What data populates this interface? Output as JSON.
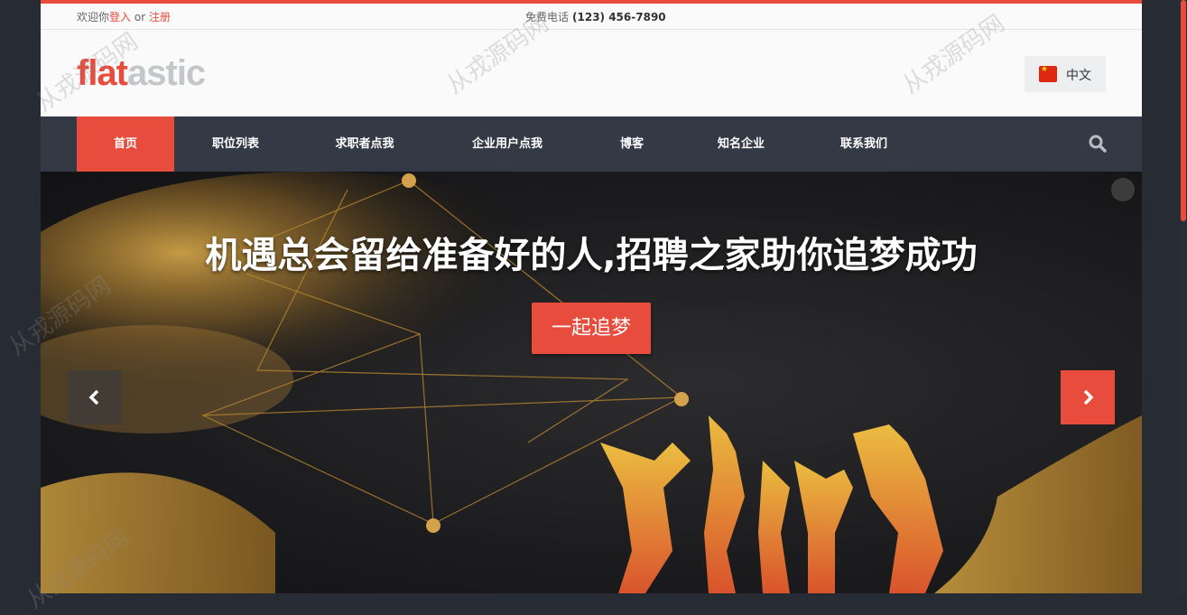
{
  "topbar": {
    "welcome": "欢迎你",
    "login": "登入",
    "or": "or",
    "register": "注册",
    "phone_label": "免费电话",
    "phone": "(123) 456-7890"
  },
  "header": {
    "logo_part1": "flat",
    "logo_part2": "astic",
    "language": "中文",
    "flag_icon": "china-flag-icon"
  },
  "nav": {
    "items": [
      {
        "label": "首页",
        "active": true
      },
      {
        "label": "职位列表"
      },
      {
        "label": "求职者点我"
      },
      {
        "label": "企业用户点我"
      },
      {
        "label": "博客"
      },
      {
        "label": "知名企业"
      },
      {
        "label": "联系我们"
      }
    ],
    "search_icon": "search-icon"
  },
  "hero": {
    "title": "机遇总会留给准备好的人,招聘之家助你追梦成功",
    "button": "一起追梦",
    "prev_icon": "chevron-left-icon",
    "next_icon": "chevron-right-icon"
  },
  "watermark": "从戎源码网",
  "colors": {
    "accent": "#e74c3c",
    "nav_bg": "#343a45",
    "frame_bg": "#272b33"
  }
}
